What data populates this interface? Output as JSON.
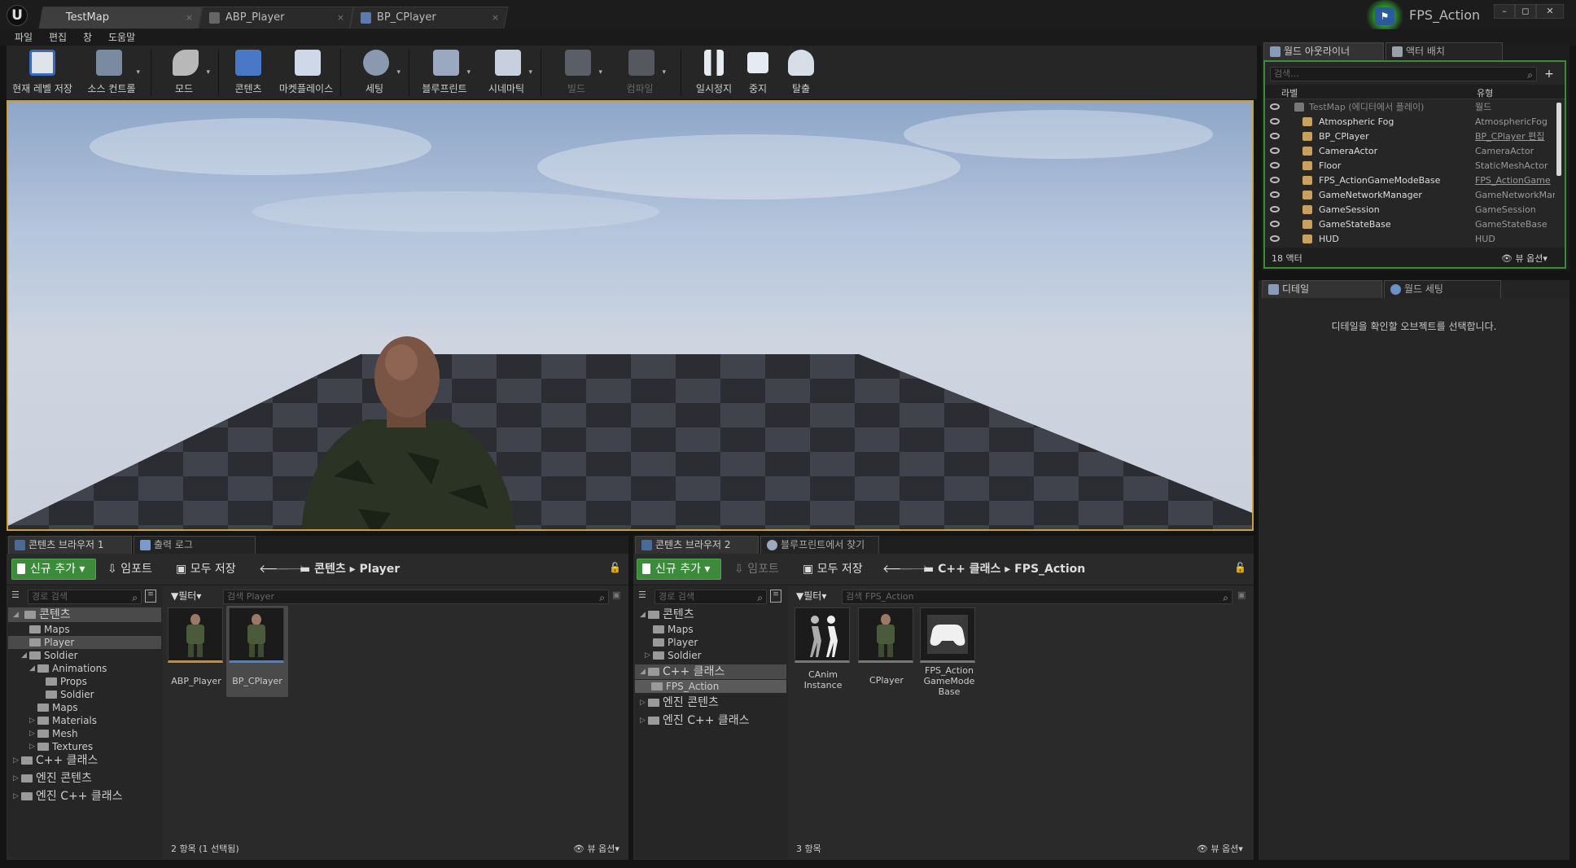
{
  "window": {
    "tabs": [
      {
        "label": "TestMap"
      },
      {
        "label": "ABP_Player"
      },
      {
        "label": "BP_CPlayer"
      }
    ],
    "project": "FPS_Action",
    "logo": "U",
    "close_glyph": "×",
    "controls": {
      "minimize": "–",
      "maximize": "◻",
      "close": "✕"
    }
  },
  "menu": {
    "file": "파일",
    "edit": "편집",
    "window": "창",
    "help": "도움말"
  },
  "toolbar": {
    "save_level": "현재 레벨 저장",
    "source_control": "소스 컨트롤",
    "modes": "모드",
    "content": "콘텐츠",
    "marketplace": "마켓플레이스",
    "settings": "세팅",
    "blueprint": "블루프린트",
    "cinematics": "시네마틱",
    "build": "빌드",
    "compile": "컴파일",
    "pause": "일시정지",
    "stop": "중지",
    "eject": "탈출",
    "dropdown_glyph": "▾"
  },
  "outliner": {
    "tab": "월드 아웃라이너",
    "tab2": "액터 배치",
    "search_placeholder": "검색...",
    "col_label": "라벨",
    "col_type": "유형",
    "root": {
      "name": "TestMap (에디터에서 플레이)",
      "type": "월드"
    },
    "rows": [
      {
        "name": "Atmospheric Fog",
        "type": "AtmosphericFog"
      },
      {
        "name": "BP_CPlayer",
        "type": "BP_CPlayer 편집"
      },
      {
        "name": "CameraActor",
        "type": "CameraActor"
      },
      {
        "name": "Floor",
        "type": "StaticMeshActor"
      },
      {
        "name": "FPS_ActionGameModeBase",
        "type": "FPS_ActionGame"
      },
      {
        "name": "GameNetworkManager",
        "type": "GameNetworkMar"
      },
      {
        "name": "GameSession",
        "type": "GameSession"
      },
      {
        "name": "GameStateBase",
        "type": "GameStateBase"
      },
      {
        "name": "HUD",
        "type": "HUD"
      }
    ],
    "count": "18 액터",
    "view_options": "뷰 옵션"
  },
  "details": {
    "tab": "디테일",
    "tab2": "월드 세팅",
    "empty": "디테일을 확인할 오브젝트를 선택합니다."
  },
  "cb1": {
    "tab": "콘텐츠 브라우저 1",
    "tab2": "출력 로그",
    "add_new": "신규 추가",
    "import": "임포트",
    "save_all": "모두 저장",
    "path": [
      "콘텐츠",
      "Player"
    ],
    "path_search": "경로 검색",
    "filter": "필터",
    "search_placeholder": "검색 Player",
    "tree": {
      "content": "콘텐츠",
      "maps": "Maps",
      "player": "Player",
      "soldier": "Soldier",
      "animations": "Animations",
      "props": "Props",
      "soldier2": "Soldier",
      "maps2": "Maps",
      "materials": "Materials",
      "mesh": "Mesh",
      "textures": "Textures",
      "cpp": "C++ 클래스",
      "engine_content": "엔진 콘텐츠",
      "engine_cpp": "엔진 C++ 클래스"
    },
    "assets": [
      {
        "name": "ABP_Player"
      },
      {
        "name": "BP_CPlayer"
      }
    ],
    "status": "2 항목 (1 선택됨)",
    "view_options": "뷰 옵션"
  },
  "cb2": {
    "tab": "콘텐츠 브라우저 2",
    "tab2": "블루프린트에서 찾기",
    "add_new": "신규 추가",
    "import": "임포트",
    "save_all": "모두 저장",
    "path": [
      "C++ 클래스",
      "FPS_Action"
    ],
    "path_search": "경로 검색",
    "filter": "필터",
    "search_placeholder": "검색 FPS_Action",
    "tree": {
      "content": "콘텐츠",
      "maps": "Maps",
      "player": "Player",
      "soldier": "Soldier",
      "cpp": "C++ 클래스",
      "fps": "FPS_Action",
      "engine_content": "엔진 콘텐츠",
      "engine_cpp": "엔진 C++ 클래스"
    },
    "assets": [
      {
        "name": "CAnim Instance"
      },
      {
        "name": "CPlayer"
      },
      {
        "name": "FPS_Action GameMode Base"
      }
    ],
    "status": "3 항목",
    "view_options": "뷰 옵션"
  },
  "colors": {
    "accent_green": "#3b8b3a",
    "viewport_border": "#c9a03a",
    "link": "#7ab0ff"
  }
}
